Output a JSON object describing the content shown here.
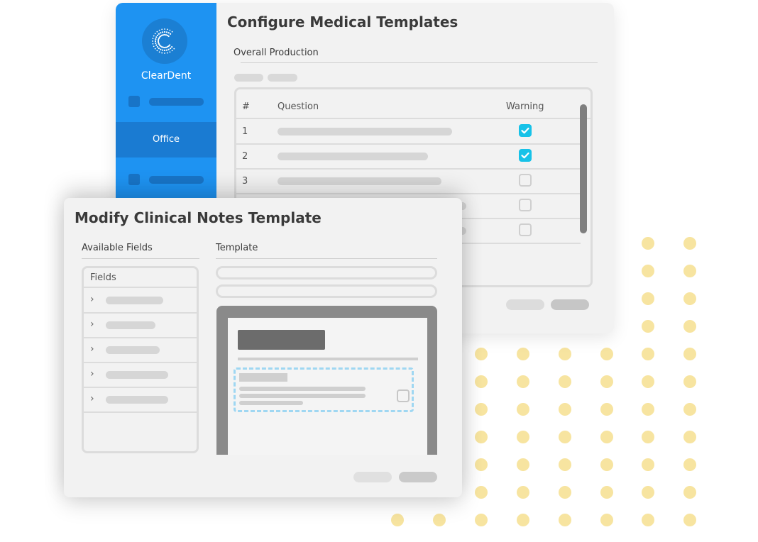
{
  "colors": {
    "brand": "#1e93f2",
    "check": "#17c2e8",
    "dots": "#f7e4a0"
  },
  "back_window": {
    "title": "Configure Medical Templates",
    "app_name": "ClearDent",
    "sidebar": {
      "active_item": "Office"
    },
    "section_title": "Overall Production",
    "table": {
      "headers": {
        "num": "#",
        "question": "Question",
        "warning": "Warning"
      },
      "rows": [
        {
          "num": "1",
          "warning": true
        },
        {
          "num": "2",
          "warning": true
        },
        {
          "num": "3",
          "warning": false
        },
        {
          "num": "",
          "warning": false
        },
        {
          "num": "",
          "warning": false
        }
      ]
    }
  },
  "front_window": {
    "title": "Modify Clinical Notes Template",
    "available_fields_label": "Available Fields",
    "fields_header": "Fields",
    "template_label": "Template",
    "icons": {
      "expand": "chevron-right-icon"
    }
  }
}
